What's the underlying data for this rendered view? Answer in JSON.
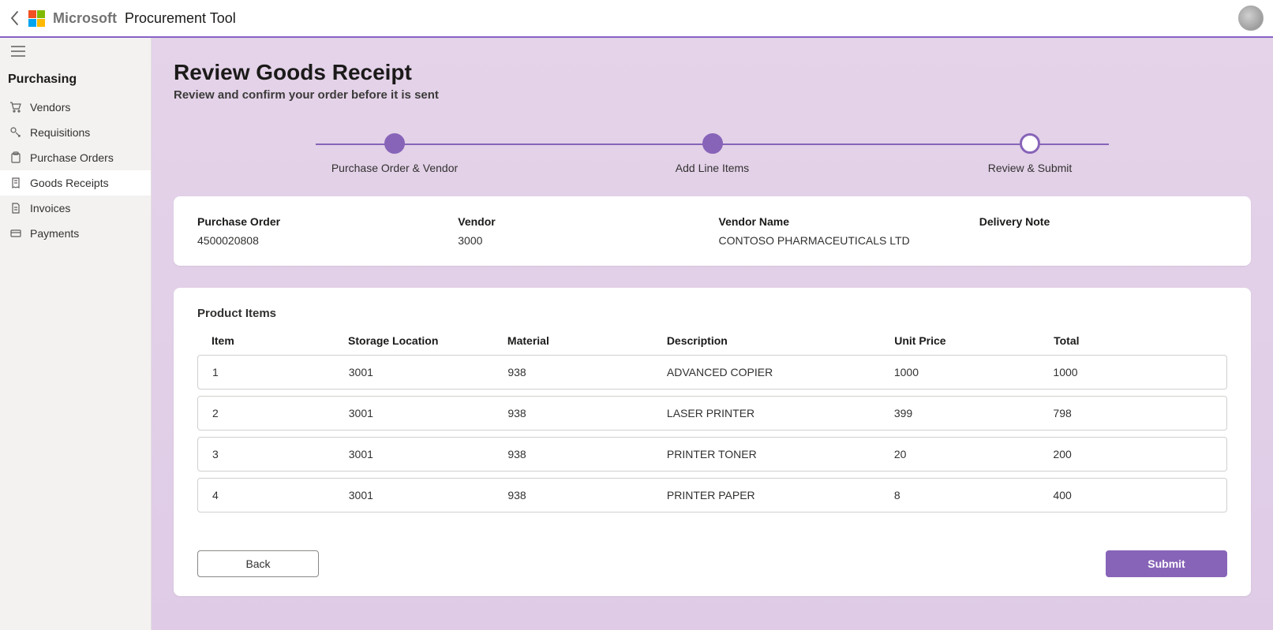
{
  "header": {
    "vendor_text": "Microsoft",
    "app_title": "Procurement Tool"
  },
  "sidebar": {
    "group_title": "Purchasing",
    "items": [
      {
        "label": "Vendors"
      },
      {
        "label": "Requisitions"
      },
      {
        "label": "Purchase Orders"
      },
      {
        "label": "Goods Receipts"
      },
      {
        "label": "Invoices"
      },
      {
        "label": "Payments"
      }
    ]
  },
  "page": {
    "title": "Review Goods Receipt",
    "subtitle": "Review and confirm your order before it is sent"
  },
  "stepper": {
    "steps": [
      {
        "label": "Purchase Order & Vendor"
      },
      {
        "label": "Add Line Items"
      },
      {
        "label": "Review & Submit"
      }
    ]
  },
  "summary": {
    "po": {
      "label": "Purchase Order",
      "value": "4500020808"
    },
    "vendor": {
      "label": "Vendor",
      "value": "3000"
    },
    "vendor_name": {
      "label": "Vendor Name",
      "value": "CONTOSO PHARMACEUTICALS LTD"
    },
    "delivery_note": {
      "label": "Delivery Note",
      "value": ""
    }
  },
  "products": {
    "section_title": "Product Items",
    "headers": {
      "item": "Item",
      "storage": "Storage Location",
      "material": "Material",
      "description": "Description",
      "unit_price": "Unit Price",
      "total": "Total"
    },
    "rows": [
      {
        "item": "1",
        "storage": "3001",
        "material": "938",
        "description": "ADVANCED COPIER",
        "unit_price": "1000",
        "total": "1000"
      },
      {
        "item": "2",
        "storage": "3001",
        "material": "938",
        "description": "LASER PRINTER",
        "unit_price": "399",
        "total": "798"
      },
      {
        "item": "3",
        "storage": "3001",
        "material": "938",
        "description": "PRINTER TONER",
        "unit_price": "20",
        "total": "200"
      },
      {
        "item": "4",
        "storage": "3001",
        "material": "938",
        "description": "PRINTER PAPER",
        "unit_price": "8",
        "total": "400"
      }
    ]
  },
  "actions": {
    "back": "Back",
    "submit": "Submit"
  }
}
